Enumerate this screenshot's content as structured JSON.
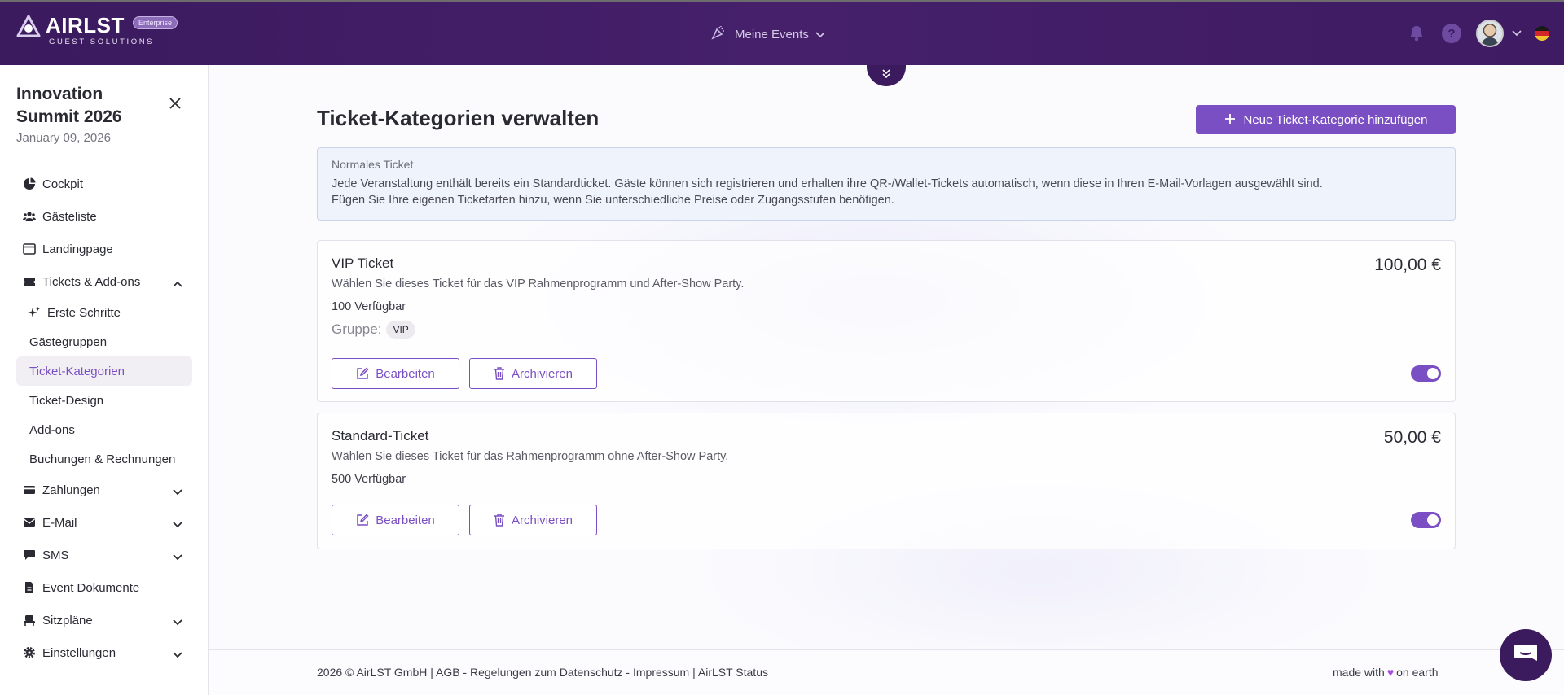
{
  "header": {
    "logo_text": "AIRLST",
    "logo_sub": "GUEST SOLUTIONS",
    "logo_badge": "Enterprise",
    "events_menu": "Meine Events",
    "help_label": "?"
  },
  "sidebar": {
    "event_title": "Innovation Summit 2026",
    "event_date": "January 09, 2026",
    "nav": {
      "cockpit": "Cockpit",
      "gaesteliste": "Gästeliste",
      "landingpage": "Landingpage",
      "tickets": "Tickets & Add-ons",
      "erste_schritte": "Erste Schritte",
      "gaestegruppen": "Gästegruppen",
      "ticket_kategorien": "Ticket-Kategorien",
      "ticket_design": "Ticket-Design",
      "addons": "Add-ons",
      "buchungen": "Buchungen & Rechnungen",
      "zahlungen": "Zahlungen",
      "email": "E-Mail",
      "sms": "SMS",
      "event_dokumente": "Event Dokumente",
      "sitzplaene": "Sitzpläne",
      "einstellungen": "Einstellungen"
    }
  },
  "main": {
    "page_title": "Ticket-Kategorien verwalten",
    "add_button": "Neue Ticket-Kategorie hinzufügen",
    "info": {
      "title": "Normales Ticket",
      "line1": "Jede Veranstaltung enthält bereits ein Standardticket. Gäste können sich registrieren und erhalten ihre QR-/Wallet-Tickets automatisch, wenn diese in Ihren E-Mail-Vorlagen ausgewählt sind.",
      "line2": "Fügen Sie Ihre eigenen Ticketarten hinzu, wenn Sie unterschiedliche Preise oder Zugangsstufen benötigen."
    },
    "tickets": [
      {
        "name": "VIP Ticket",
        "price": "100,00 €",
        "description": "Wählen Sie dieses Ticket für das VIP Rahmenprogramm und After-Show Party.",
        "availability": "100 Verfügbar",
        "group_label": "Gruppe:",
        "group_chip": "VIP",
        "edit_label": "Bearbeiten",
        "archive_label": "Archivieren",
        "enabled": true
      },
      {
        "name": "Standard-Ticket",
        "price": "50,00 €",
        "description": "Wählen Sie dieses Ticket für das Rahmenprogramm ohne After-Show Party.",
        "availability": "500 Verfügbar",
        "edit_label": "Bearbeiten",
        "archive_label": "Archivieren",
        "enabled": true
      }
    ]
  },
  "footer": {
    "left": "2026 © AirLST GmbH | AGB - Regelungen zum Datenschutz - Impressum | AirLST Status",
    "made_with": "made with",
    "heart": "♥",
    "on_earth": "on earth"
  },
  "colors": {
    "header_bg": "#3b1a5e",
    "accent": "#7b4fc4",
    "info_bg": "#eef3fc"
  }
}
